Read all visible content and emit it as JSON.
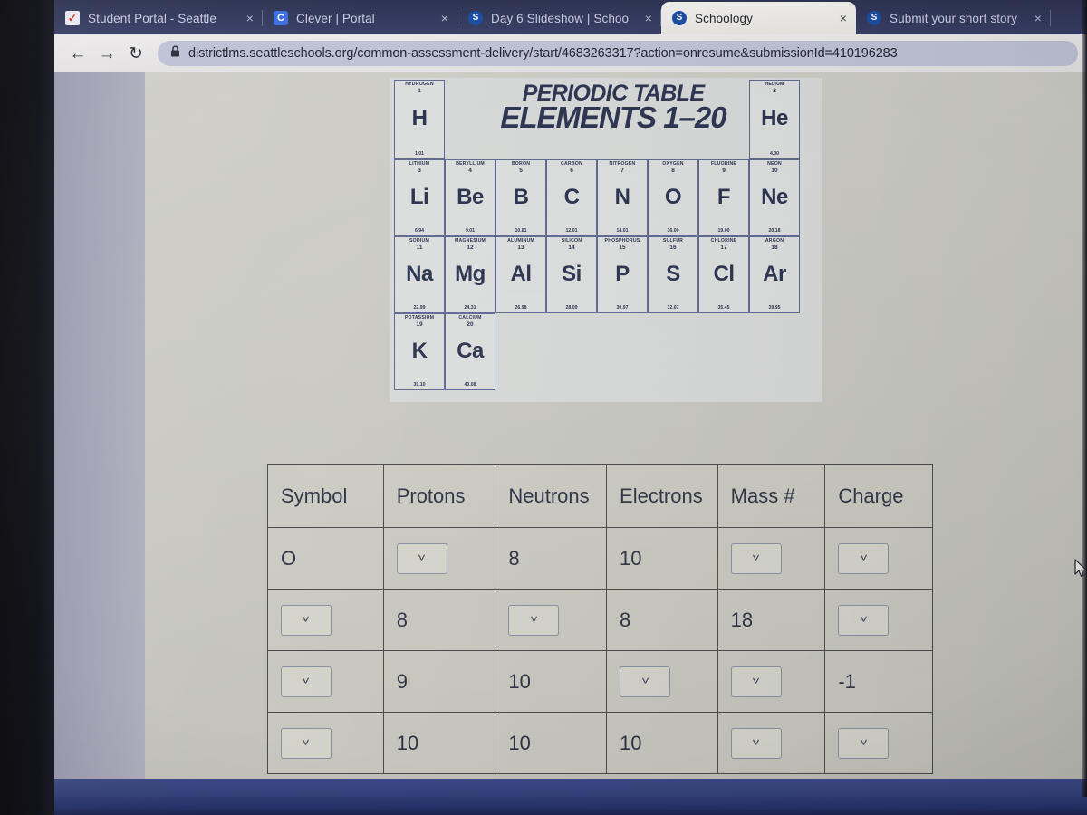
{
  "browser": {
    "tabs": [
      {
        "title": "Student Portal - Seattle",
        "favicon": "checkmark-icon",
        "close": "×",
        "active": false
      },
      {
        "title": "Clever | Portal",
        "favicon": "clever-c-icon",
        "close": "×",
        "active": false
      },
      {
        "title": "Day 6 Slideshow | Schoo",
        "favicon": "schoology-s-icon",
        "close": "×",
        "active": false
      },
      {
        "title": "Schoology",
        "favicon": "schoology-s-icon",
        "close": "×",
        "active": true
      },
      {
        "title": "Submit your short story",
        "favicon": "schoology-s-icon",
        "close": "×",
        "active": false
      }
    ],
    "toolbar": {
      "back": "←",
      "forward": "→",
      "reload": "↻",
      "lock": "🔒",
      "url": "districtlms.seattleschools.org/common-assessment-delivery/start/4683263317?action=onresume&submissionId=410196283"
    }
  },
  "periodic_table": {
    "title_line1": "PERIODIC TABLE",
    "title_line2": "ELEMENTS 1–20",
    "elements": [
      {
        "name": "HYDROGEN",
        "number": "1",
        "symbol": "H",
        "mass": "1.01",
        "col": 1,
        "row": 1
      },
      {
        "name": "HELIUM",
        "number": "2",
        "symbol": "He",
        "mass": "4.00",
        "col": 8,
        "row": 1
      },
      {
        "name": "LITHIUM",
        "number": "3",
        "symbol": "Li",
        "mass": "6.94",
        "col": 1,
        "row": 2
      },
      {
        "name": "BERYLLIUM",
        "number": "4",
        "symbol": "Be",
        "mass": "9.01",
        "col": 2,
        "row": 2
      },
      {
        "name": "BORON",
        "number": "5",
        "symbol": "B",
        "mass": "10.81",
        "col": 3,
        "row": 2
      },
      {
        "name": "CARBON",
        "number": "6",
        "symbol": "C",
        "mass": "12.01",
        "col": 4,
        "row": 2
      },
      {
        "name": "NITROGEN",
        "number": "7",
        "symbol": "N",
        "mass": "14.01",
        "col": 5,
        "row": 2
      },
      {
        "name": "OXYGEN",
        "number": "8",
        "symbol": "O",
        "mass": "16.00",
        "col": 6,
        "row": 2
      },
      {
        "name": "FLUORINE",
        "number": "9",
        "symbol": "F",
        "mass": "19.00",
        "col": 7,
        "row": 2
      },
      {
        "name": "NEON",
        "number": "10",
        "symbol": "Ne",
        "mass": "20.18",
        "col": 8,
        "row": 2
      },
      {
        "name": "SODIUM",
        "number": "11",
        "symbol": "Na",
        "mass": "22.99",
        "col": 1,
        "row": 3
      },
      {
        "name": "MAGNESIUM",
        "number": "12",
        "symbol": "Mg",
        "mass": "24.31",
        "col": 2,
        "row": 3
      },
      {
        "name": "ALUMINUM",
        "number": "13",
        "symbol": "Al",
        "mass": "26.98",
        "col": 3,
        "row": 3
      },
      {
        "name": "SILICON",
        "number": "14",
        "symbol": "Si",
        "mass": "28.09",
        "col": 4,
        "row": 3
      },
      {
        "name": "PHOSPHORUS",
        "number": "15",
        "symbol": "P",
        "mass": "30.97",
        "col": 5,
        "row": 3
      },
      {
        "name": "SULFUR",
        "number": "16",
        "symbol": "S",
        "mass": "32.07",
        "col": 6,
        "row": 3
      },
      {
        "name": "CHLORINE",
        "number": "17",
        "symbol": "Cl",
        "mass": "35.45",
        "col": 7,
        "row": 3
      },
      {
        "name": "ARGON",
        "number": "18",
        "symbol": "Ar",
        "mass": "39.95",
        "col": 8,
        "row": 3
      },
      {
        "name": "POTASSIUM",
        "number": "19",
        "symbol": "K",
        "mass": "39.10",
        "col": 1,
        "row": 4
      },
      {
        "name": "CALCIUM",
        "number": "20",
        "symbol": "Ca",
        "mass": "40.08",
        "col": 2,
        "row": 4
      }
    ]
  },
  "answer_table": {
    "headers": [
      "Symbol",
      "Protons",
      "Neutrons",
      "Electrons",
      "Mass #",
      "Charge"
    ],
    "dropdown_glyph": "˅",
    "rows": [
      [
        {
          "type": "text",
          "value": "O"
        },
        {
          "type": "dropdown",
          "value": ""
        },
        {
          "type": "text",
          "value": "8"
        },
        {
          "type": "text",
          "value": "10"
        },
        {
          "type": "dropdown",
          "value": ""
        },
        {
          "type": "dropdown",
          "value": ""
        }
      ],
      [
        {
          "type": "dropdown",
          "value": ""
        },
        {
          "type": "text",
          "value": "8"
        },
        {
          "type": "dropdown",
          "value": ""
        },
        {
          "type": "text",
          "value": "8"
        },
        {
          "type": "text",
          "value": "18"
        },
        {
          "type": "dropdown",
          "value": ""
        }
      ],
      [
        {
          "type": "dropdown",
          "value": ""
        },
        {
          "type": "text",
          "value": "9"
        },
        {
          "type": "text",
          "value": "10"
        },
        {
          "type": "dropdown",
          "value": ""
        },
        {
          "type": "dropdown",
          "value": ""
        },
        {
          "type": "text",
          "value": "-1"
        }
      ],
      [
        {
          "type": "dropdown",
          "value": ""
        },
        {
          "type": "text",
          "value": "10"
        },
        {
          "type": "text",
          "value": "10"
        },
        {
          "type": "text",
          "value": "10"
        },
        {
          "type": "dropdown",
          "value": ""
        },
        {
          "type": "dropdown",
          "value": ""
        }
      ]
    ]
  },
  "colors": {
    "tabbar": "#343a5e",
    "toolbar": "#e8e6e6",
    "omnibox": "#bfc2d6",
    "page_bg": "#c9c9c2",
    "table_border": "#4a4a4a",
    "pt_ink": "#28304d",
    "bottom_band": "#33407b"
  }
}
